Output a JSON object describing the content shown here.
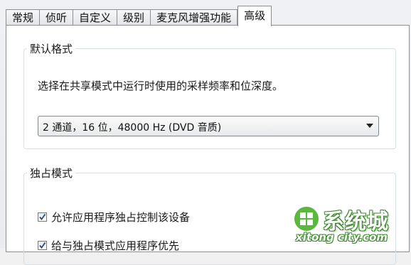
{
  "tabs": [
    {
      "label": "常规",
      "active": false
    },
    {
      "label": "侦听",
      "active": false
    },
    {
      "label": "自定义",
      "active": false
    },
    {
      "label": "级别",
      "active": false
    },
    {
      "label": "麦克风增强功能",
      "active": false
    },
    {
      "label": "高级",
      "active": true
    }
  ],
  "default_format": {
    "legend": "默认格式",
    "description": "选择在共享模式中运行时使用的采样频率和位深度。",
    "select_value": "2 通道，16 位，48000 Hz (DVD 音质)"
  },
  "exclusive_mode": {
    "legend": "独占模式",
    "options": [
      {
        "label": "允许应用程序独占控制该设备",
        "checked": true
      },
      {
        "label": "给与独占模式应用程序优先",
        "checked": true
      }
    ]
  },
  "watermark": {
    "cn": "系统城",
    "en": "xitong city.com"
  },
  "colors": {
    "tab_border": "#8e8f8f",
    "group_border": "#d5dfe5",
    "check_mark": "#2b4a7a",
    "watermark_green": "#3b8a2a"
  }
}
